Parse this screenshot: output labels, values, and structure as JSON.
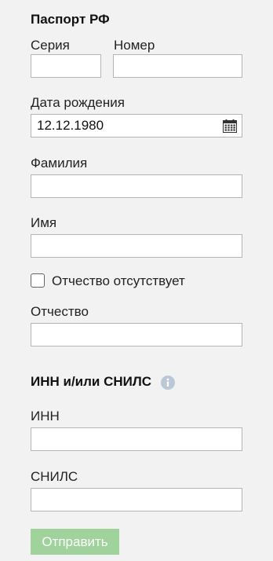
{
  "passport": {
    "title": "Паспорт РФ",
    "series_label": "Серия",
    "series_value": "",
    "number_label": "Номер",
    "number_value": ""
  },
  "birth_date": {
    "label": "Дата рождения",
    "value": "12.12.1980",
    "icon": "calendar-icon"
  },
  "last_name": {
    "label": "Фамилия",
    "value": ""
  },
  "first_name": {
    "label": "Имя",
    "value": ""
  },
  "no_patronymic": {
    "label": "Отчество отсутствует",
    "checked": false
  },
  "patronymic": {
    "label": "Отчество",
    "value": ""
  },
  "tax": {
    "title": "ИНН и/или СНИЛС",
    "info_icon": "info-icon",
    "inn_label": "ИНН",
    "inn_value": "",
    "snils_label": "СНИЛС",
    "snils_value": ""
  },
  "submit": {
    "label": "Отправить",
    "color": "#9fd39b"
  },
  "colors": {
    "background": "#f2f2f2",
    "border": "#b5b5b5",
    "info_icon": "#b9c7d6"
  }
}
